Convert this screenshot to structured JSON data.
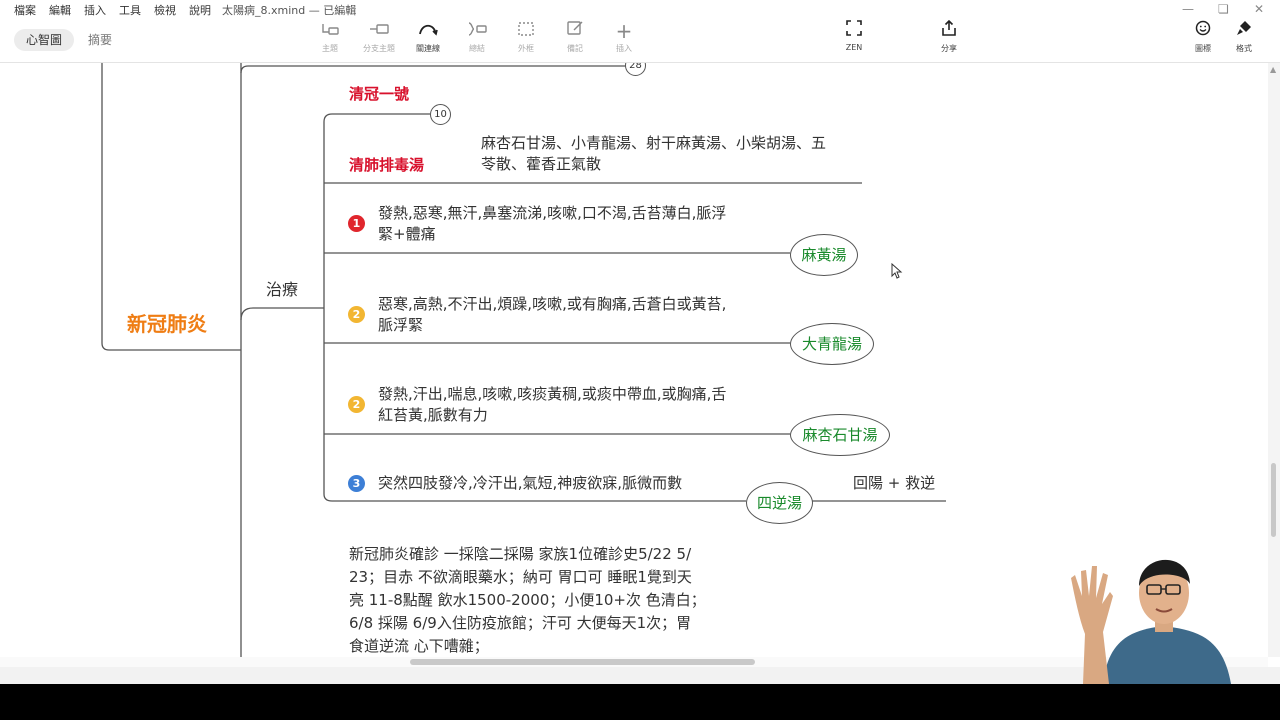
{
  "menu": [
    "檔案",
    "編輯",
    "插入",
    "工具",
    "檢視",
    "說明"
  ],
  "window_title": "太陽病_8.xmind — 已編輯",
  "view_tabs": {
    "mindmap": "心智圖",
    "outline": "摘要"
  },
  "tools": [
    {
      "label": "主題",
      "icon": "topic-icon"
    },
    {
      "label": "分支主題",
      "icon": "subtopic-icon"
    },
    {
      "label": "關連線",
      "icon": "relationship-icon"
    },
    {
      "label": "總結",
      "icon": "summary-icon"
    },
    {
      "label": "外框",
      "icon": "boundary-icon"
    },
    {
      "label": "備記",
      "icon": "note-icon"
    },
    {
      "label": "插入",
      "icon": "plus-icon"
    }
  ],
  "right_tools": {
    "zen": "ZEN",
    "share": "分享",
    "icons": "圖標",
    "format": "格式"
  },
  "map": {
    "root": "新冠肺炎",
    "treat": "治療",
    "count_top": "28",
    "qingguan_label": "清冠一號",
    "qingguan_count": "10",
    "qingfei_label": "清肺排毒湯",
    "qingfei_desc_1": "麻杏石甘湯、小青龍湯、射干麻黃湯、小柴胡湯、五",
    "qingfei_desc_2": "苓散、藿香正氣散",
    "items": [
      {
        "priority": "1",
        "badge_color": "#e0262d",
        "line1": "發熱,惡寒,無汗,鼻塞流涕,咳嗽,口不渴,舌苔薄白,脈浮",
        "line2": "緊+體痛",
        "formula": "麻黃湯"
      },
      {
        "priority": "2",
        "badge_color": "#f2b632",
        "line1": "惡寒,高熱,不汗出,煩躁,咳嗽,或有胸痛,舌蒼白或黃苔,",
        "line2": "脈浮緊",
        "formula": "大青龍湯"
      },
      {
        "priority": "2",
        "badge_color": "#f2b632",
        "line1": "發熱,汗出,喘息,咳嗽,咳痰黃稠,或痰中帶血,或胸痛,舌",
        "line2": "紅苔黃,脈數有力",
        "formula": "麻杏石甘湯"
      },
      {
        "priority": "3",
        "badge_color": "#3d7fd6",
        "line1": "突然四肢發冷,冷汗出,氣短,神疲欲寐,脈微而數",
        "line2": "",
        "formula": "四逆湯"
      }
    ],
    "return_yang": "回陽 + 救逆",
    "case_lines": [
      "新冠肺炎確診 一採陰二採陽 家族1位確診史5/22 5/",
      "23；目赤 不欲滴眼藥水；納可 胃口可 睡眠1覺到天",
      "亮 11-8點醒 飲水1500-2000；小便10+次 色清白；",
      "6/8 採陽 6/9入住防疫旅館；汗可 大便每天1次；胃",
      "食道逆流 心下嘈雜；"
    ]
  },
  "colors": {
    "root": "#ef7d14",
    "label_red": "#d8112c",
    "formula_green": "#1a8a2c",
    "line": "#555555"
  }
}
